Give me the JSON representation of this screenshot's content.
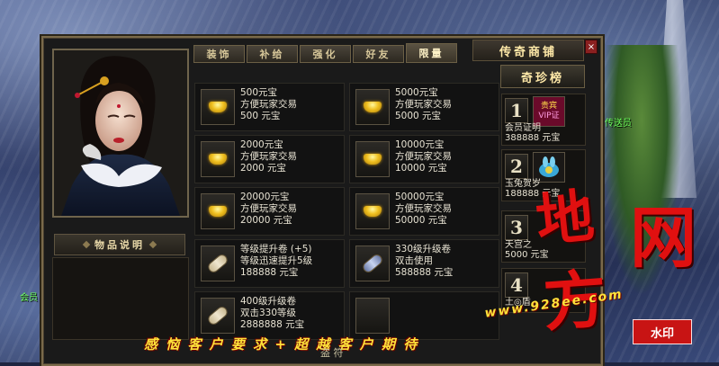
{
  "map": {
    "label_left": "会员",
    "label_right": "传送员"
  },
  "left_panel": {
    "description_title": "物品说明"
  },
  "tabs": [
    {
      "label": "装饰",
      "active": false
    },
    {
      "label": "补给",
      "active": false
    },
    {
      "label": "强化",
      "active": false
    },
    {
      "label": "好友",
      "active": false
    },
    {
      "label": "限量",
      "active": true
    }
  ],
  "shop_title": "传奇商铺",
  "close_label": "×",
  "items": [
    {
      "icon": "gold-ingot-icon",
      "name": "500元宝",
      "desc": "方便玩家交易",
      "price": "500  元宝"
    },
    {
      "icon": "gold-ingot-icon",
      "name": "5000元宝",
      "desc": "方便玩家交易",
      "price": "5000  元宝"
    },
    {
      "icon": "gold-ingot-icon",
      "name": "2000元宝",
      "desc": "方便玩家交易",
      "price": "2000  元宝"
    },
    {
      "icon": "gold-ingot-icon",
      "name": "10000元宝",
      "desc": "方便玩家交易",
      "price": "10000  元宝"
    },
    {
      "icon": "gold-ingot-icon",
      "name": "20000元宝",
      "desc": "方便玩家交易",
      "price": "20000  元宝"
    },
    {
      "icon": "gold-ingot-icon",
      "name": "50000元宝",
      "desc": "方便玩家交易",
      "price": "50000  元宝"
    },
    {
      "icon": "scroll-icon",
      "name": "等级提升卷 (+5)",
      "desc": "等级迅速提升5级",
      "price": "188888  元宝"
    },
    {
      "icon": "blue-scroll-icon",
      "name": "330级升级卷",
      "desc": "双击使用",
      "price": "588888  元宝"
    },
    {
      "icon": "scroll-icon",
      "name": "400级升级卷",
      "desc": "双击330等级",
      "price": "2888888  元宝"
    },
    {
      "icon": "empty-slot",
      "name": "",
      "desc": "",
      "price": ""
    }
  ],
  "ranking": {
    "title": "奇珍榜",
    "entries": [
      {
        "rank": "1",
        "badge_line1": "贵宾",
        "badge_line2": "VIP证",
        "name": "会员证明",
        "price": "388888  元宝"
      },
      {
        "rank": "2",
        "badge_line1": "",
        "badge_line2": "",
        "name": "玉兔贺岁",
        "price": "188888  元宝"
      },
      {
        "rank": "3",
        "badge_line1": "",
        "badge_line2": "",
        "name": "天宫之",
        "price": "5000  元宝"
      },
      {
        "rank": "4",
        "badge_line1": "",
        "badge_line2": "",
        "name": "土◎盾",
        "price": ""
      }
    ]
  },
  "watermark": {
    "big1": "地",
    "big2": "网",
    "big3": "方",
    "stamp": "水印",
    "bottom_text": "感 恼 客 户 要 求 + 超 越 客 户 期 待 ",
    "web_text": "www.928ee.com",
    "center_fragment": "盗 符"
  }
}
